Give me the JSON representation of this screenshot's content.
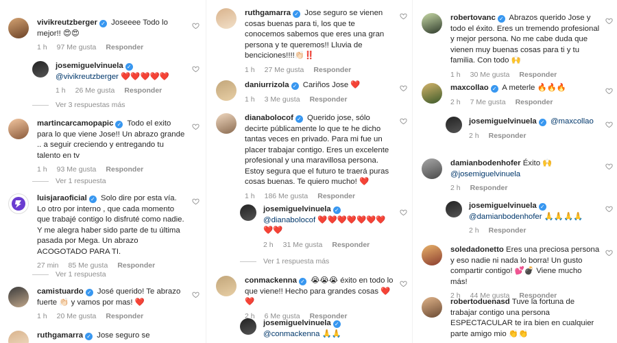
{
  "labels": {
    "likes_suffix": "Me gusta",
    "reply": "Responder"
  },
  "colors": {
    "verified": "#3897f0",
    "mention": "#00376b",
    "meta": "#8e8e8e",
    "heart_red": "#ed4956"
  },
  "columns": [
    {
      "items": [
        {
          "kind": "comment",
          "user": "vivikreutzberger",
          "text": "Joseeee Todo lo mejor!! 😍😍",
          "time": "1 h",
          "likes": "97 Me gusta"
        },
        {
          "kind": "reply",
          "user": "josemiguelvinuela",
          "mention": "@vivikreutzberger",
          "text": " ❤️❤️❤️❤️❤️",
          "time": "1 h",
          "likes": "26 Me gusta"
        },
        {
          "kind": "more",
          "text": "Ver 3 respuestas más"
        },
        {
          "kind": "comment",
          "user": "martincarcamopapic",
          "text": "Todo el exito para lo que viene Jose!! Un abrazo grande .. a seguir creciendo y entregando tu talento en tv",
          "time": "1 h",
          "likes": "93 Me gusta"
        },
        {
          "kind": "more",
          "text": "Ver 1 respuesta"
        },
        {
          "kind": "comment",
          "user": "luisjaraoficial",
          "text": "Solo dire por esta vía. Lo otro por interno , que cada momento que trabajé contigo lo disfruté como nadie. Y me alegra haber sido parte de tu última pasada por Mega. Un abrazo ACOGOTADO PARA TI.",
          "time": "27 min",
          "likes": "85 Me gusta"
        },
        {
          "kind": "more",
          "text": "Ver 1 respuesta"
        },
        {
          "kind": "comment",
          "user": "camistuardo",
          "text": "José querido! Te abrazo fuerte 👏🏻 y vamos por mas! ❤️",
          "time": "1 h",
          "likes": "20 Me gusta"
        },
        {
          "kind": "comment",
          "user": "ruthgamarra",
          "text": "Jose seguro se",
          "time": "",
          "likes": ""
        }
      ]
    },
    {
      "items": [
        {
          "kind": "comment",
          "user": "ruthgamarra",
          "text": "Jose seguro se vienen cosas buenas para ti, los que te conocemos sabemos que eres una gran persona y te queremos!! Lluvia de benciciones!!!!👏🏻‼️",
          "time": "1 h",
          "likes": "27 Me gusta"
        },
        {
          "kind": "comment",
          "user": "daniurrizola",
          "text": "Cariños Jose ❤️",
          "time": "1 h",
          "likes": "3 Me gusta"
        },
        {
          "kind": "comment",
          "user": "dianabolocof",
          "text": "Querido jose, sólo decirte públicamente lo que te he dicho tantas veces en privado. Para mi fue un placer trabajar contigo. Eres un excelente profesional y una maravillosa persona. Estoy segura que el futuro te traerá puras cosas buenas. Te quiero mucho! ❤️",
          "time": "1 h",
          "likes": "186 Me gusta"
        },
        {
          "kind": "reply",
          "user": "josemiguelvinuela",
          "mention": "@dianabolocof",
          "text": " ❤️❤️❤️❤️❤️❤️❤️❤️❤️",
          "time": "2 h",
          "likes": "31 Me gusta"
        },
        {
          "kind": "more",
          "text": "Ver 1 respuesta más"
        },
        {
          "kind": "comment",
          "user": "conmackenna",
          "text": "😭😭😭 éxito en todo lo que viene!! Hecho para grandes cosas ❤️❤️",
          "time": "2 h",
          "likes": "6 Me gusta"
        },
        {
          "kind": "reply",
          "user": "josemiguelvinuela",
          "mention": "@conmackenna",
          "text": " 🙏🙏",
          "time": "",
          "likes": ""
        }
      ]
    },
    {
      "items": [
        {
          "kind": "comment",
          "user": "robertovanc",
          "text": "Abrazos querido Jose y todo el éxito. Eres un tremendo profesional y mejor persona. No me cabe duda que vienen muy buenas cosas para ti y tu familia. Con todo 🙌",
          "time": "1 h",
          "likes": "30 Me gusta"
        },
        {
          "kind": "comment",
          "user": "maxcollao",
          "text": "A meterle 🔥🔥🔥",
          "time": "2 h",
          "likes": "7 Me gusta"
        },
        {
          "kind": "reply",
          "user": "josemiguelvinuela",
          "mention": "@maxcollao",
          "text": "",
          "time": "2 h",
          "likes": ""
        },
        {
          "kind": "comment",
          "user": "damianbodenhofer",
          "text": "Éxito 🙌",
          "mention2": "@josemiguelvinuela",
          "time": "2 h",
          "likes": ""
        },
        {
          "kind": "reply",
          "user": "josemiguelvinuela",
          "mention": "@damianbodenhofer",
          "text": " 🙏🙏🙏🙏",
          "time": "2 h",
          "likes": ""
        },
        {
          "kind": "comment",
          "user": "soledadonetto",
          "text": "Eres una preciosa persona y eso nadie ni nada lo borra! Un gusto compartir contigo! 💕💣 Viene mucho más!",
          "time": "2 h",
          "likes": "44 Me gusta"
        },
        {
          "kind": "comment",
          "user": "robertoduenasd",
          "text": "Tuve la fortuna de trabajar contigo una persona ESPECTACULAR te ira bien en cualquier parte amigo mio 👏👏",
          "time": "",
          "likes": ""
        }
      ]
    }
  ]
}
